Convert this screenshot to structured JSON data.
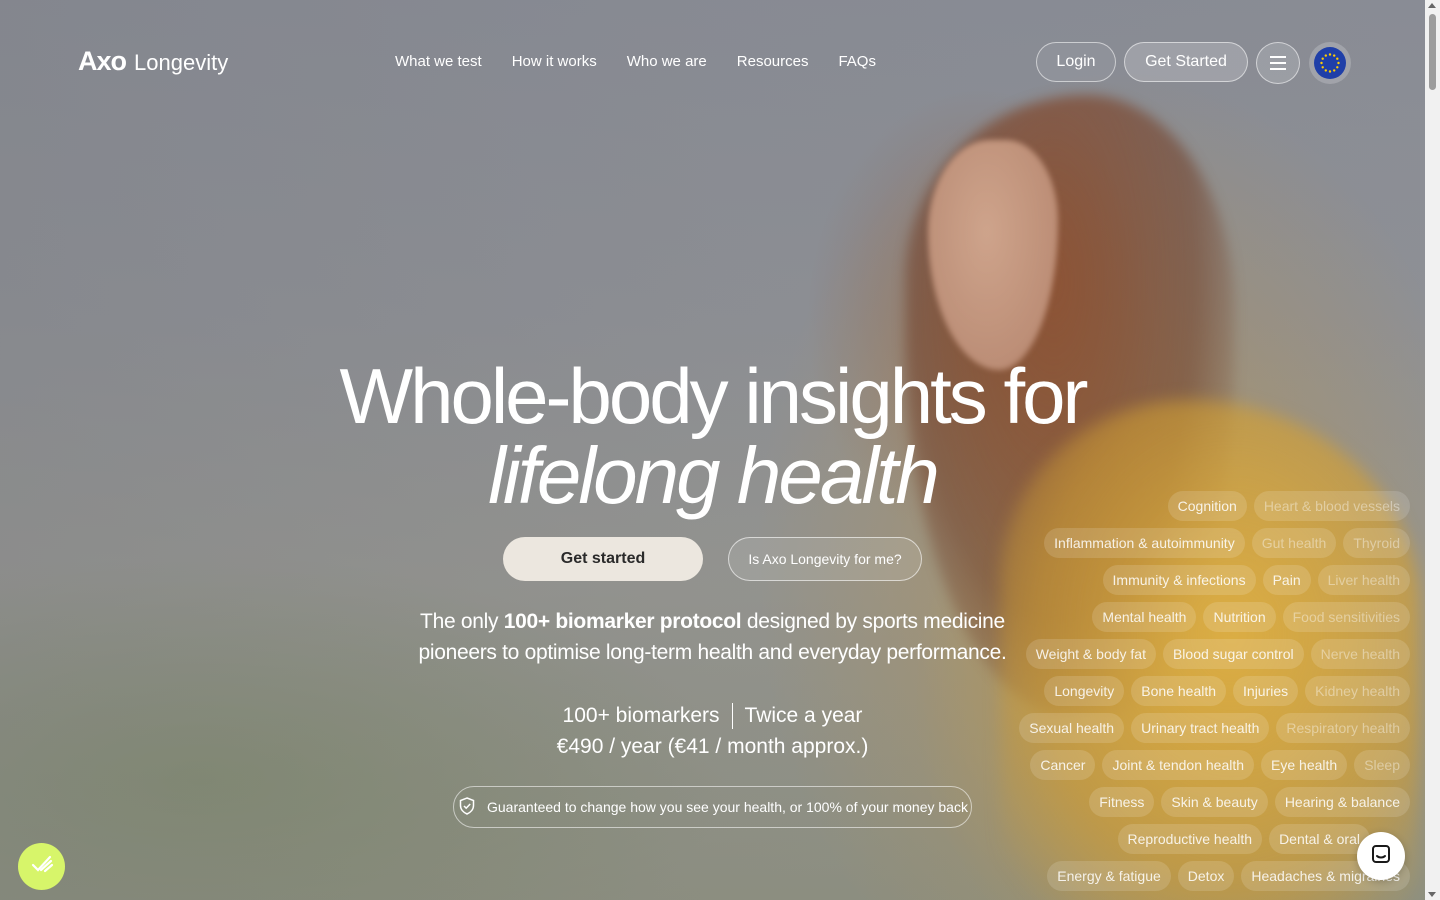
{
  "header": {
    "logo_mark": "Axo",
    "logo_text": "Longevity",
    "nav": [
      "What we test",
      "How it works",
      "Who we are",
      "Resources",
      "FAQs"
    ],
    "login": "Login",
    "get_started": "Get Started"
  },
  "hero": {
    "headline_line1": "Whole-body insights for",
    "headline_line2": "lifelong health",
    "cta_primary": "Get started",
    "cta_secondary": "Is Axo Longevity for me?",
    "subcopy_before": "The only ",
    "subcopy_bold": "100+ biomarker protocol",
    "subcopy_after": " designed by sports medicine pioneers to optimise long-term health and everyday performance.",
    "pricing_biomarkers": "100+ biomarkers",
    "pricing_frequency": "Twice a year",
    "pricing_price": "€490 / year (€41 / month approx.)",
    "guarantee": "Guaranteed to change how you see your health, or 100% of your money back"
  },
  "tags": [
    [
      "Cognition",
      "Heart & blood vessels"
    ],
    [
      "Inflammation & autoimmunity",
      "Gut health",
      "Thyroid"
    ],
    [
      "Immunity & infections",
      "Pain",
      "Liver health"
    ],
    [
      "Mental health",
      "Nutrition",
      "Food sensitivities"
    ],
    [
      "Weight & body fat",
      "Blood sugar control",
      "Nerve health"
    ],
    [
      "Longevity",
      "Bone health",
      "Injuries",
      "Kidney health"
    ],
    [
      "Sexual health",
      "Urinary tract health",
      "Respiratory health"
    ],
    [
      "Cancer",
      "Joint & tendon health",
      "Eye health",
      "Sleep"
    ],
    [
      "Fitness",
      "Skin & beauty",
      "Hearing & balance"
    ],
    [
      "Reproductive health",
      "Dental & oral"
    ],
    [
      "Energy & fatigue",
      "Detox",
      "Headaches & migraines"
    ]
  ],
  "colors": {
    "cta_bg": "#ece7df",
    "accent_green": "#d7f56a",
    "eu_blue": "#1f3fa8"
  }
}
